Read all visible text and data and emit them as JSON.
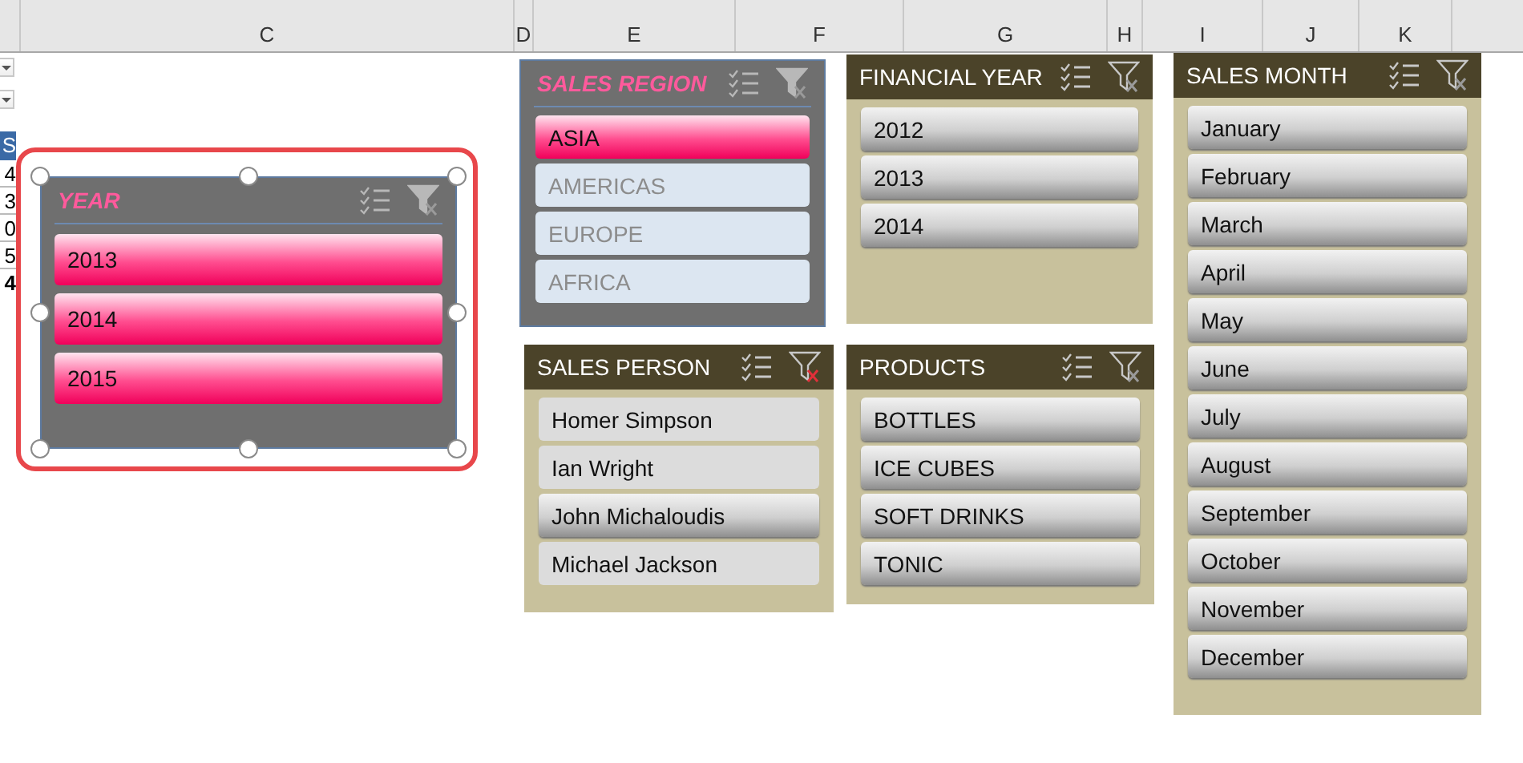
{
  "column_headers": [
    "C",
    "D",
    "E",
    "F",
    "G",
    "H",
    "I",
    "J",
    "K"
  ],
  "left_edge": {
    "header": "S",
    "cells": [
      "4",
      "3",
      "0",
      "5",
      "4"
    ]
  },
  "slicers": [
    {
      "title": "YEAR",
      "kind": "pink",
      "selected": true,
      "clear_filter_enabled": false,
      "items": [
        {
          "label": "2013",
          "selected": true
        },
        {
          "label": "2014",
          "selected": true
        },
        {
          "label": "2015",
          "selected": true
        }
      ]
    },
    {
      "title": "SALES REGION",
      "kind": "pink",
      "selected": false,
      "clear_filter_enabled": false,
      "items": [
        {
          "label": "ASIA",
          "selected": true
        },
        {
          "label": "AMERICAS",
          "selected": false
        },
        {
          "label": "EUROPE",
          "selected": false
        },
        {
          "label": "AFRICA",
          "selected": false
        }
      ]
    },
    {
      "title": "FINANCIAL YEAR",
      "kind": "tan",
      "selected": false,
      "clear_filter_enabled": false,
      "items": [
        {
          "label": "2012",
          "selected": true
        },
        {
          "label": "2013",
          "selected": true
        },
        {
          "label": "2014",
          "selected": true
        }
      ]
    },
    {
      "title": "SALES MONTH",
      "kind": "tan",
      "selected": false,
      "clear_filter_enabled": false,
      "items": [
        {
          "label": "January",
          "selected": true
        },
        {
          "label": "February",
          "selected": true
        },
        {
          "label": "March",
          "selected": true
        },
        {
          "label": "April",
          "selected": true
        },
        {
          "label": "May",
          "selected": true
        },
        {
          "label": "June",
          "selected": true
        },
        {
          "label": "July",
          "selected": true
        },
        {
          "label": "August",
          "selected": true
        },
        {
          "label": "September",
          "selected": true
        },
        {
          "label": "October",
          "selected": true
        },
        {
          "label": "November",
          "selected": true
        },
        {
          "label": "December",
          "selected": true
        }
      ]
    },
    {
      "title": "SALES PERSON",
      "kind": "tan",
      "selected": false,
      "clear_filter_enabled": true,
      "items": [
        {
          "label": "Homer Simpson",
          "selected": false
        },
        {
          "label": "Ian Wright",
          "selected": false
        },
        {
          "label": "John Michaloudis",
          "selected": true
        },
        {
          "label": "Michael Jackson",
          "selected": false
        }
      ]
    },
    {
      "title": "PRODUCTS",
      "kind": "tan",
      "selected": false,
      "clear_filter_enabled": false,
      "items": [
        {
          "label": "BOTTLES",
          "selected": true
        },
        {
          "label": "ICE CUBES",
          "selected": true
        },
        {
          "label": "SOFT DRINKS",
          "selected": true
        },
        {
          "label": "TONIC",
          "selected": true
        }
      ]
    }
  ]
}
